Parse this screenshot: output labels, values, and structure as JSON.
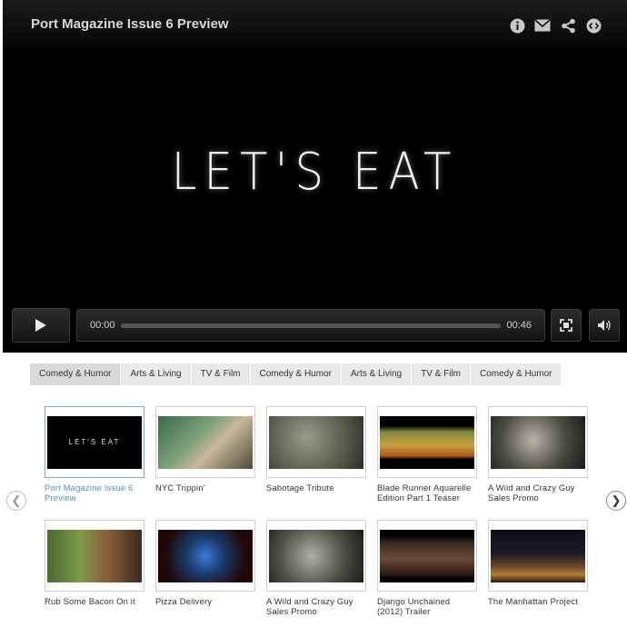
{
  "player": {
    "title": "Port Magazine Issue 6 Preview",
    "icons": [
      "info-icon",
      "email-icon",
      "share-icon",
      "embed-icon"
    ],
    "video_text": "LET'S EAT",
    "current_time": "00:00",
    "duration": "00:46",
    "progress": 0
  },
  "tabs": [
    "Comedy & Humor",
    "Arts & Living",
    "TV & Film",
    "Comedy & Humor",
    "Arts & Living",
    "TV & Film",
    "Comedy & Humor"
  ],
  "videos": [
    {
      "label": "Port Magazine Issue 6 Preview",
      "thumb_text": "LET'S EAT"
    },
    {
      "label": "NYC Trippin'"
    },
    {
      "label": "Sabotage Tribute"
    },
    {
      "label": "Blade Runner Aquarelle Edition Part 1 Teaser"
    },
    {
      "label": "A Wild and Crazy Guy Sales Promo"
    },
    {
      "label": "Rub Some Bacon On it"
    },
    {
      "label": "Pizza Delivery"
    },
    {
      "label": "A Wild and Crazy Guy Sales Promo"
    },
    {
      "label": "Django Unchained (2012) Trailer"
    },
    {
      "label": "The Manhattan Project"
    }
  ],
  "colors": {
    "accent": "#4a93c0",
    "player_bg": "#000000",
    "tab_bg": "#e9e9e9"
  }
}
